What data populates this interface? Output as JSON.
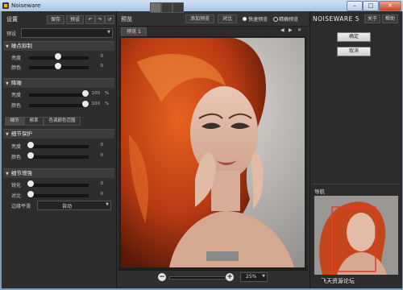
{
  "window": {
    "title": "Noiseware"
  },
  "left": {
    "header": "设置",
    "save_label": "保存",
    "delete_label": "预设",
    "preset_label": "预设",
    "sections": [
      {
        "title": "噪点抑制",
        "sliders": [
          {
            "label": "亮度",
            "value": "0"
          },
          {
            "label": "颜色",
            "value": "0"
          }
        ]
      },
      {
        "title": "降噪",
        "sliders": [
          {
            "label": "亮度",
            "value": "100",
            "unit": "%"
          },
          {
            "label": "颜色",
            "value": "100",
            "unit": "%"
          }
        ]
      },
      {
        "title": "细节保护",
        "sliders": [
          {
            "label": "亮度",
            "value": "0"
          },
          {
            "label": "颜色",
            "value": "0"
          }
        ]
      },
      {
        "title": "细节增强",
        "sliders": [
          {
            "label": "锐化",
            "value": "0"
          },
          {
            "label": "对比",
            "value": "0"
          }
        ],
        "edge_label": "边缘平滑",
        "edge_value": "自动"
      }
    ],
    "tabs": [
      "细节",
      "频率",
      "色调颜色范围"
    ]
  },
  "center": {
    "header": "预览",
    "add_preview_label": "添加预览",
    "compare_label": "对比",
    "fast_preview_label": "快速预览",
    "accurate_preview_label": "精确预览",
    "photo_tab": "预览 1",
    "zoom_value": "25%"
  },
  "right": {
    "logo": "NOISEWARE 5",
    "about_label": "关于",
    "help_label": "帮助",
    "ok_label": "确定",
    "cancel_label": "取消",
    "navigator_label": "导航"
  },
  "watermark": "飞天资源论坛",
  "colors": {
    "panel": "#2d2d2d",
    "titlebar": "#a9c4e3",
    "accent": "#e63a2e"
  },
  "state": {
    "slider_levels": [
      0.5,
      0.5,
      1.0,
      1.0,
      0.0,
      0.0,
      0.0,
      0.0
    ]
  }
}
